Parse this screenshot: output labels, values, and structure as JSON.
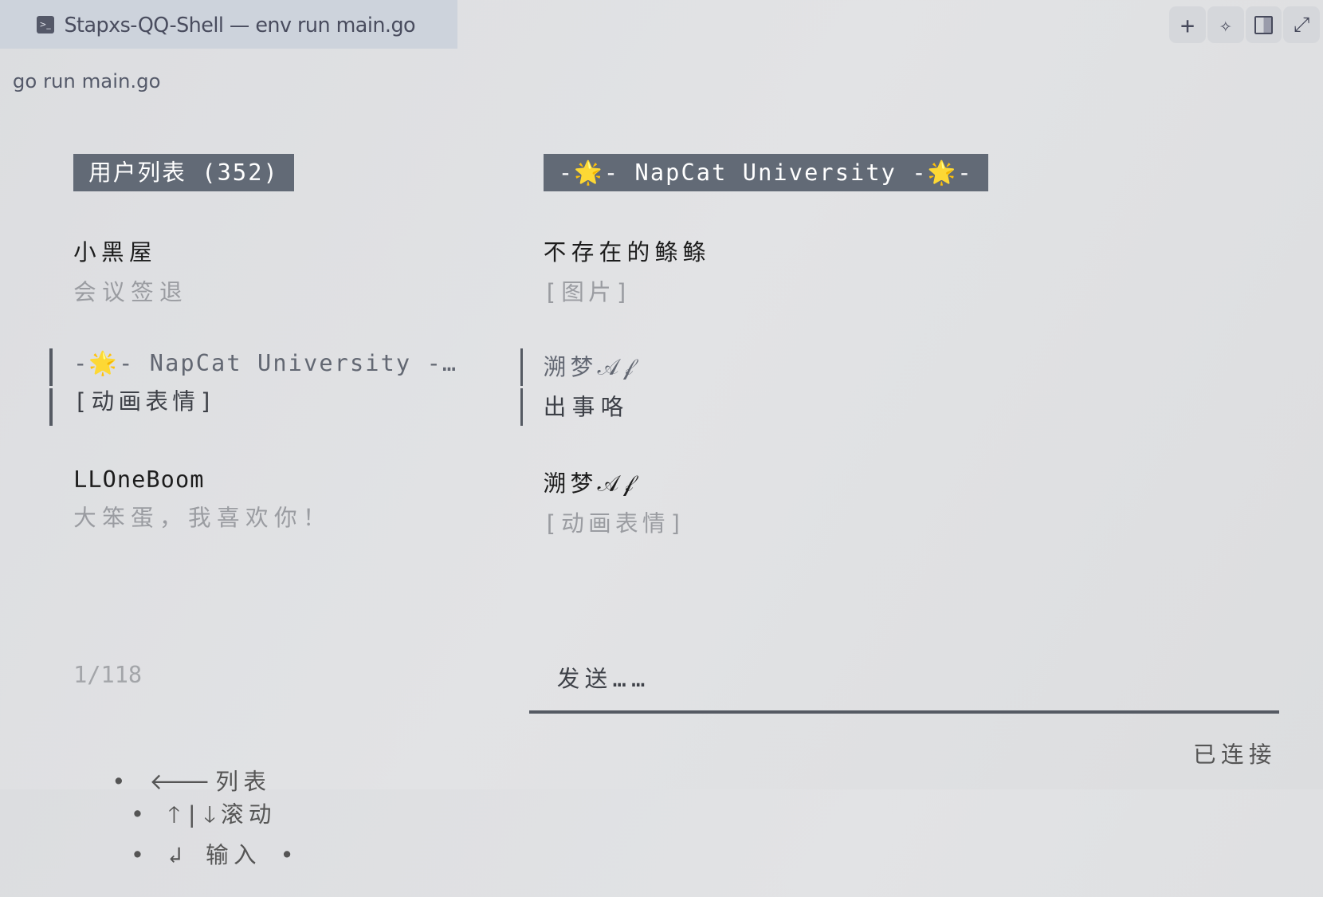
{
  "window": {
    "title": "Stapxs-QQ-Shell — env run main.go",
    "command": "go run main.go",
    "toolbar": [
      "plus-icon",
      "sparkles-icon",
      "split-view-icon",
      "expand-icon"
    ]
  },
  "user_list": {
    "header": "用户列表 (352)",
    "items": [
      {
        "name": "小黑屋",
        "last_message": "会议签退",
        "selected": false
      },
      {
        "name": "-🌟- NapCat University -…",
        "last_message": "[动画表情]",
        "selected": true
      },
      {
        "name": "LLOneBoom",
        "last_message": "大笨蛋，我喜欢你！",
        "selected": false
      }
    ],
    "page": "1/118"
  },
  "chat": {
    "header": "-🌟- NapCat University -🌟-",
    "messages": [
      {
        "sender": "不存在的鲦鲦",
        "content": "[图片]",
        "selected": false
      },
      {
        "sender": "溯梦𝒜𝒻",
        "content": "出事咯",
        "selected": true
      },
      {
        "sender": "溯梦𝒜𝒻",
        "content": "[动画表情]",
        "selected": false
      }
    ],
    "input_placeholder": "发送……"
  },
  "help": {
    "list": "列表",
    "scroll": "滚动",
    "input": "输入",
    "status": "已连接"
  }
}
